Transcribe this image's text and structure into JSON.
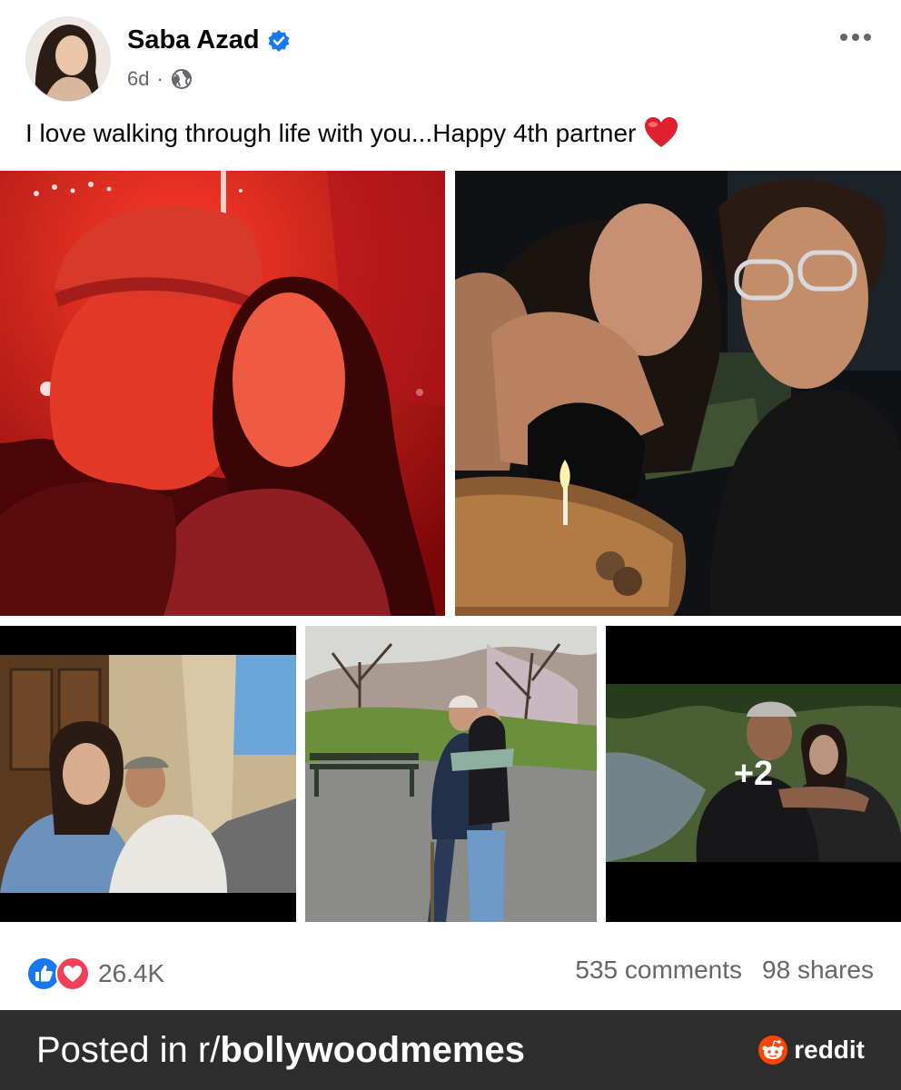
{
  "post": {
    "author": "Saba Azad",
    "verified": true,
    "time": "6d",
    "separator": "·",
    "privacy_icon": "globe-icon",
    "caption": "I love walking through life with you...Happy 4th partner",
    "caption_emoji": "red-heart-icon"
  },
  "photos": {
    "more_count": "+2",
    "items": [
      {
        "description_icon": "photo-red-selfie"
      },
      {
        "description_icon": "photo-birthday-candle"
      },
      {
        "description_icon": "photo-street-sitting"
      },
      {
        "description_icon": "photo-park-hug"
      },
      {
        "description_icon": "photo-lake-hug"
      }
    ]
  },
  "reactions": {
    "icons": [
      "like-icon",
      "love-icon"
    ],
    "count": "26.4K",
    "like_color": "#1877f2",
    "love_color": "#f33e58"
  },
  "engagement": {
    "comments": "535 comments",
    "shares": "98 shares"
  },
  "footer": {
    "prefix": "Posted in r/",
    "subreddit": "bollywoodmemes",
    "brand": "reddit",
    "brand_color": "#ff4500"
  }
}
